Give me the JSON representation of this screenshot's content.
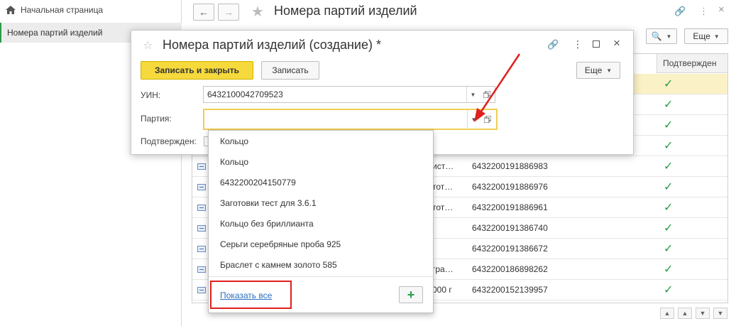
{
  "sidebar": {
    "home_label": "Начальная страница",
    "selected_label": "Номера партий изделий"
  },
  "main": {
    "title": "Номера партий изделий",
    "more_label": "Еще",
    "column_confirmed": "Подтвержден",
    "rows": [
      {
        "name": "",
        "number": "",
        "confirmed": true,
        "highlight": true
      },
      {
        "name": "",
        "number": "",
        "confirmed": true
      },
      {
        "name": "",
        "number": "",
        "confirmed": true
      },
      {
        "name": "",
        "number": "",
        "confirmed": true
      },
      {
        "name": "ист…",
        "number": "6432200191886983",
        "confirmed": true
      },
      {
        "name": "тот…",
        "number": "6432200191886976",
        "confirmed": true
      },
      {
        "name": "тот…",
        "number": "6432200191886961",
        "confirmed": true
      },
      {
        "name": "",
        "number": "6432200191386740",
        "confirmed": true
      },
      {
        "name": "",
        "number": "6432200191386672",
        "confirmed": true
      },
      {
        "name": "гра…",
        "number": "6432200186898262",
        "confirmed": true
      },
      {
        "name": "000 г",
        "number": "6432200152139957",
        "confirmed": true
      }
    ]
  },
  "dialog": {
    "title": "Номера партий изделий (создание) *",
    "save_close_label": "Записать и закрыть",
    "save_label": "Записать",
    "more_label": "Еще",
    "uin_label": "УИН:",
    "uin_value": "6432100042709523",
    "party_label": "Партия:",
    "party_value": "",
    "confirmed_label": "Подтвержден:"
  },
  "dropdown": {
    "items": [
      "Кольцо",
      "Кольцо",
      "6432200204150779",
      "Заготовки тест для 3.6.1",
      "Кольцо без бриллианта",
      "Серьги серебряные проба 925",
      "Браслет с камнем золото 585"
    ],
    "show_all_label": "Показать все",
    "add_label": "+"
  },
  "colors": {
    "accent_yellow": "#f6d93c",
    "check_green": "#2b9b4a",
    "annotation_red": "#e0201c",
    "link_blue": "#2a6fbf"
  }
}
